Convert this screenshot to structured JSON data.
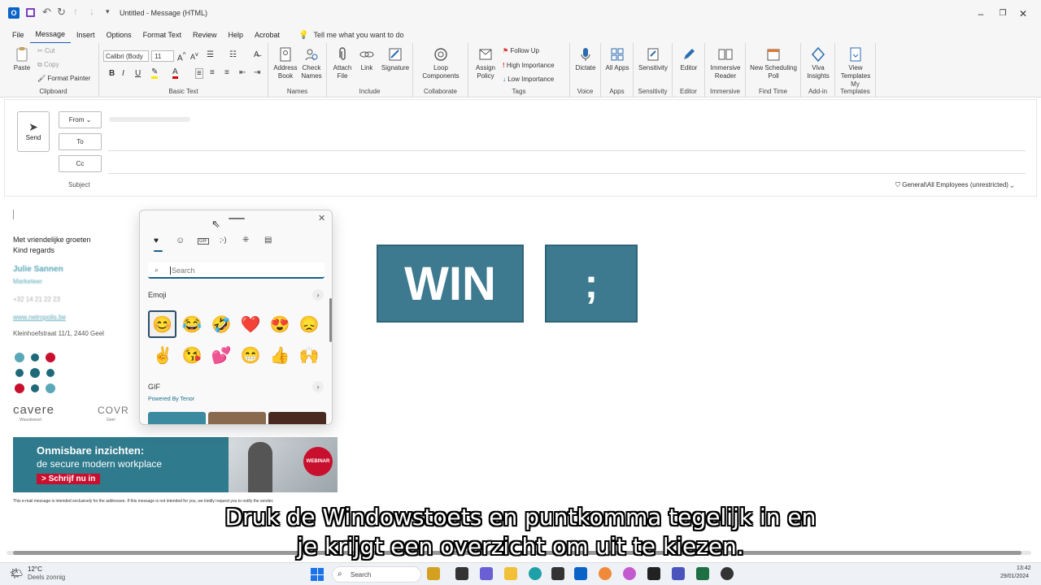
{
  "titlebar": {
    "title": "Untitled - Message (HTML)",
    "quick_access_more": "▾"
  },
  "menu": [
    "File",
    "Message",
    "Insert",
    "Options",
    "Format Text",
    "Review",
    "Help",
    "Acrobat"
  ],
  "tellme": "Tell me what you want to do",
  "ribbon": {
    "clipboard": {
      "paste": "Paste",
      "cut": "Cut",
      "copy": "Copy",
      "format_painter": "Format Painter",
      "label": "Clipboard"
    },
    "basic_text": {
      "font": "Calibri (Body",
      "size": "11",
      "bold": "B",
      "italic": "I",
      "underline": "U",
      "label": "Basic Text"
    },
    "names": {
      "address_book": "Address Book",
      "check_names": "Check Names",
      "label": "Names"
    },
    "include": {
      "attach_file": "Attach File",
      "link": "Link",
      "signature": "Signature",
      "label": "Include"
    },
    "collaborate": {
      "loop": "Loop Components",
      "label": "Collaborate"
    },
    "tags": {
      "assign_policy": "Assign Policy",
      "follow_up": "Follow Up",
      "high": "High Importance",
      "low": "Low Importance",
      "label": "Tags"
    },
    "voice": {
      "dictate": "Dictate",
      "label": "Voice"
    },
    "apps": {
      "all_apps": "All Apps",
      "label": "Apps"
    },
    "sensitivity": {
      "sensitivity": "Sensitivity",
      "label": "Sensitivity"
    },
    "editor": {
      "editor": "Editor",
      "label": "Editor"
    },
    "immersive": {
      "reader": "Immersive Reader",
      "label": "Immersive"
    },
    "findtime": {
      "poll": "New Scheduling Poll",
      "label": "Find Time"
    },
    "addin": {
      "viva": "Viva Insights",
      "label": "Add-in"
    },
    "templates": {
      "view": "View Templates",
      "label": "My Templates"
    }
  },
  "compose": {
    "send": "Send",
    "from": "From",
    "to": "To",
    "cc": "Cc",
    "subject": "Subject",
    "sensitivity_label": "General\\All Employees (unrestricted)"
  },
  "signature": {
    "greeting1": "Met vriendelijke groeten",
    "greeting2": "Kind regards",
    "name": "Julie Sannen",
    "role": "Marketeer",
    "phone": "+32 14 21 22 23",
    "website": "www.netropolis.be",
    "address": "Kleinhoefstraat 11/1, 2440 Geel",
    "logo1": "cavere",
    "logo1_sub": "Wuustwezel",
    "logo2": "COVR",
    "logo2_sub": "Geel",
    "banner_title": "Onmisbare inzichten:",
    "banner_sub": "de secure modern workplace",
    "banner_cta": "> Schrijf nu in",
    "banner_badge": "WEBINAR",
    "disclaimer": "This e-mail message is intended exclusively for the addressee. If this message is not intended for you, we kindly request you to notify the sender."
  },
  "emoji_panel": {
    "search_placeholder": "Search",
    "section_emoji": "Emoji",
    "section_gif": "GIF",
    "powered": "Powered By Tenor",
    "emojis_row1": [
      "😊",
      "😂",
      "🤣",
      "❤️",
      "😍",
      "😞"
    ],
    "emojis_row2": [
      "✌️",
      "😘",
      "💕",
      "😁",
      "👍",
      "🙌"
    ]
  },
  "keys": {
    "win": "WIN",
    "semicolon": ";"
  },
  "captions": {
    "line1": "Druk de Windowstoets en puntkomma tegelijk in en",
    "line2": "je krijgt een overzicht om uit te kiezen."
  },
  "taskbar": {
    "temp": "12°C",
    "weather": "Deels zonnig",
    "search": "Search",
    "time": "13:42",
    "date": "29/01/2024"
  },
  "colors": {
    "accent": "#185abd",
    "key": "#3d7a8f",
    "banner": "#2f7a8c",
    "cta": "#c8102e"
  }
}
